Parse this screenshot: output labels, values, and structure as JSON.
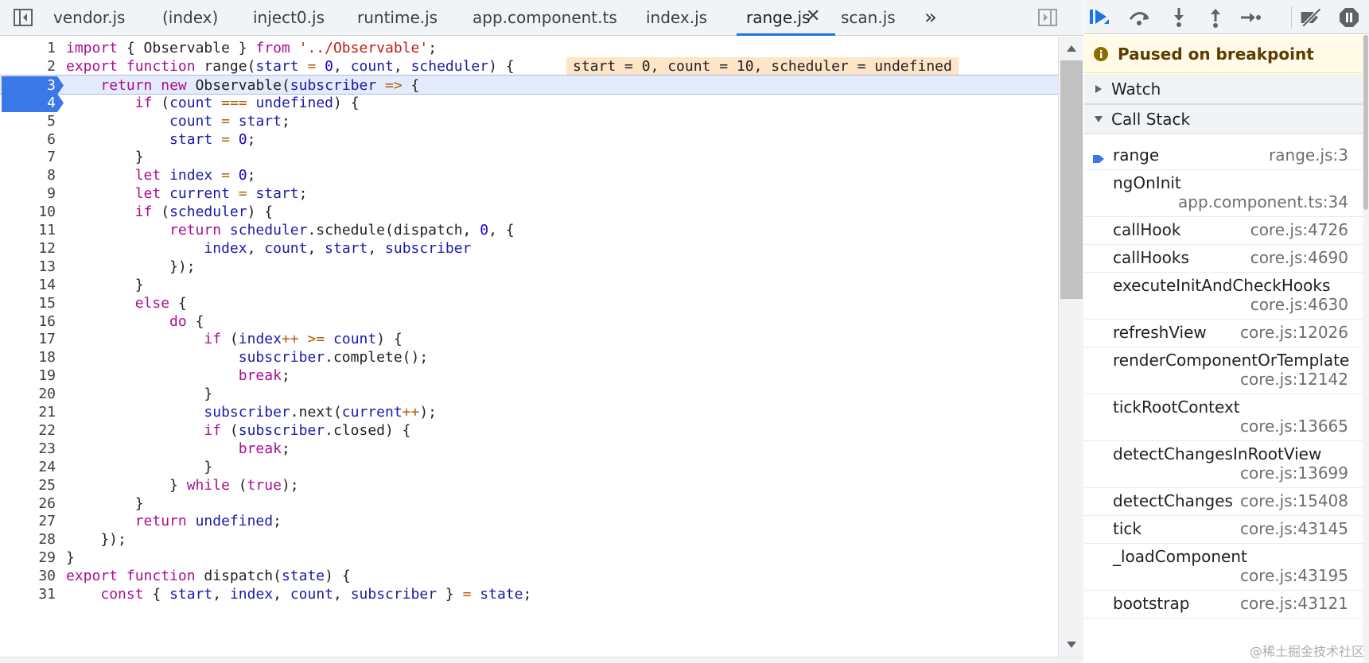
{
  "tabs": [
    {
      "label": "vendor.js",
      "active": false
    },
    {
      "label": "(index)",
      "active": false
    },
    {
      "label": "inject0.js",
      "active": false
    },
    {
      "label": "runtime.js",
      "active": false
    },
    {
      "label": "app.component.ts",
      "active": false
    },
    {
      "label": "index.js",
      "active": false
    },
    {
      "label": "range.js",
      "active": true
    },
    {
      "label": "scan.js",
      "active": false
    }
  ],
  "tab_close_glyph": "✕",
  "tab_overflow_glyph": "»",
  "icons": {
    "toggle_navigator": "sidebar-left-icon",
    "toggle_debugger": "sidebar-right-icon",
    "resume": "resume-icon",
    "step_over": "step-over-icon",
    "step_into": "step-into-icon",
    "step_out": "step-out-icon",
    "step": "step-icon",
    "deactivate_breakpoints": "deactivate-breakpoints-icon",
    "pause_on_exceptions": "pause-exceptions-icon"
  },
  "colors": {
    "accent": "#1a73e8",
    "exec_line_bg": "#e4ebfb",
    "breakpoint": "#3b78e7",
    "inline_value_bg": "#ffe5c6",
    "paused_banner_bg": "#fffbe6"
  },
  "code": {
    "execution_line": 3,
    "breakpoint_lines": [
      3,
      4
    ],
    "inline_value_line": 2,
    "inline_value": "start = 0, count = 10, scheduler = undefined",
    "lines": [
      "import { Observable } from '../Observable';",
      "export function range(start = 0, count, scheduler) {",
      "    return new Observable(subscriber => {",
      "        if (count === undefined) {",
      "            count = start;",
      "            start = 0;",
      "        }",
      "        let index = 0;",
      "        let current = start;",
      "        if (scheduler) {",
      "            return scheduler.schedule(dispatch, 0, {",
      "                index, count, start, subscriber",
      "            });",
      "        }",
      "        else {",
      "            do {",
      "                if (index++ >= count) {",
      "                    subscriber.complete();",
      "                    break;",
      "                }",
      "                subscriber.next(current++);",
      "                if (subscriber.closed) {",
      "                    break;",
      "                }",
      "            } while (true);",
      "        }",
      "        return undefined;",
      "    });",
      "}",
      "export function dispatch(state) {",
      "    const { start, index, count, subscriber } = state;"
    ]
  },
  "debugger": {
    "paused_text": "Paused on breakpoint",
    "watch_label": "Watch",
    "callstack_label": "Call Stack",
    "frames": [
      {
        "name": "range",
        "location": "range.js:3",
        "current": true,
        "two_line": false
      },
      {
        "name": "ngOnInit",
        "location": "app.component.ts:34",
        "current": false,
        "two_line": true
      },
      {
        "name": "callHook",
        "location": "core.js:4726",
        "current": false,
        "two_line": false
      },
      {
        "name": "callHooks",
        "location": "core.js:4690",
        "current": false,
        "two_line": false
      },
      {
        "name": "executeInitAndCheckHooks",
        "location": "core.js:4630",
        "current": false,
        "two_line": true
      },
      {
        "name": "refreshView",
        "location": "core.js:12026",
        "current": false,
        "two_line": false
      },
      {
        "name": "renderComponentOrTemplate",
        "location": "core.js:12142",
        "current": false,
        "two_line": true
      },
      {
        "name": "tickRootContext",
        "location": "core.js:13665",
        "current": false,
        "two_line": true
      },
      {
        "name": "detectChangesInRootView",
        "location": "core.js:13699",
        "current": false,
        "two_line": true
      },
      {
        "name": "detectChanges",
        "location": "core.js:15408",
        "current": false,
        "two_line": false
      },
      {
        "name": "tick",
        "location": "core.js:43145",
        "current": false,
        "two_line": false
      },
      {
        "name": "_loadComponent",
        "location": "core.js:43195",
        "current": false,
        "two_line": true
      },
      {
        "name": "bootstrap",
        "location": "core.js:43121",
        "current": false,
        "two_line": false
      }
    ]
  },
  "watermark": "@稀土掘金技术社区"
}
